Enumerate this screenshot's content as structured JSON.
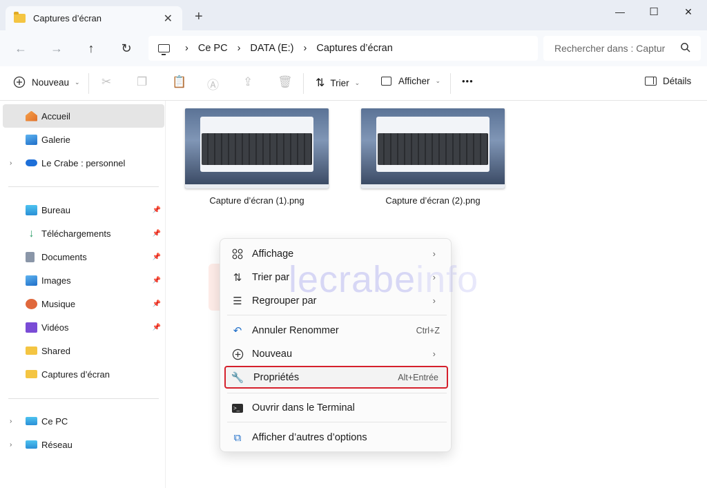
{
  "window": {
    "tab_title": "Captures d’écran",
    "tab_close": "✕",
    "tab_add": "+",
    "minimize": "—",
    "maximize": "☐",
    "close": "✕"
  },
  "address": {
    "segments": [
      "Ce PC",
      "DATA (E:)",
      "Captures d’écran"
    ],
    "search_placeholder": "Rechercher dans : Captur"
  },
  "toolbar": {
    "new_label": "Nouveau",
    "sort_label": "Trier",
    "view_label": "Afficher",
    "more_label": "•••",
    "details_label": "Détails"
  },
  "sidebar": {
    "top": [
      {
        "label": "Accueil",
        "icon": "home-icon",
        "color": "#f08c3c"
      },
      {
        "label": "Galerie",
        "icon": "gallery-icon",
        "color": "#2b7fd6"
      },
      {
        "label": "Le Crabe : personnel",
        "icon": "onedrive-icon",
        "color": "#1d6fd8"
      }
    ],
    "quick": [
      {
        "label": "Bureau",
        "icon": "desktop-icon",
        "color": "#34a8e0"
      },
      {
        "label": "Téléchargements",
        "icon": "download-icon",
        "color": "#2fa06a"
      },
      {
        "label": "Documents",
        "icon": "documents-icon",
        "color": "#8a96a8"
      },
      {
        "label": "Images",
        "icon": "images-icon",
        "color": "#2b7fd6"
      },
      {
        "label": "Musique",
        "icon": "music-icon",
        "color": "#e0683c"
      },
      {
        "label": "Vidéos",
        "icon": "videos-icon",
        "color": "#7a4cd6"
      },
      {
        "label": "Shared",
        "icon": "folder-icon",
        "color": "#f4c542"
      },
      {
        "label": "Captures d’écran",
        "icon": "folder-icon",
        "color": "#f4c542"
      }
    ],
    "bottom": [
      {
        "label": "Ce PC",
        "icon": "pc-icon",
        "color": "#2b8fd6"
      },
      {
        "label": "Réseau",
        "icon": "network-icon",
        "color": "#2b8fd6"
      }
    ]
  },
  "files": [
    {
      "name": "Capture d’écran (1).png"
    },
    {
      "name": "Capture d’écran (2).png"
    }
  ],
  "context_menu": {
    "items": [
      {
        "label": "Affichage",
        "icon": "grid-icon",
        "shortcut": "",
        "submenu": true
      },
      {
        "label": "Trier par",
        "icon": "sort-icon",
        "shortcut": "",
        "submenu": true
      },
      {
        "label": "Regrouper par",
        "icon": "group-icon",
        "shortcut": "",
        "submenu": true
      },
      {
        "label": "Annuler Renommer",
        "icon": "undo-icon",
        "shortcut": "Ctrl+Z",
        "submenu": false
      },
      {
        "label": "Nouveau",
        "icon": "new-icon",
        "shortcut": "",
        "submenu": true
      },
      {
        "label": "Propriétés",
        "icon": "wrench-icon",
        "shortcut": "Alt+Entrée",
        "submenu": false,
        "highlighted": true
      },
      {
        "label": "Ouvrir dans le Terminal",
        "icon": "terminal-icon",
        "shortcut": "",
        "submenu": false
      },
      {
        "label": "Afficher d’autres d’options",
        "icon": "more-options-icon",
        "shortcut": "",
        "submenu": false
      }
    ],
    "highlight_color": "#d51f2b"
  },
  "watermark": {
    "part1": "lecrabe",
    "part2": "info"
  }
}
